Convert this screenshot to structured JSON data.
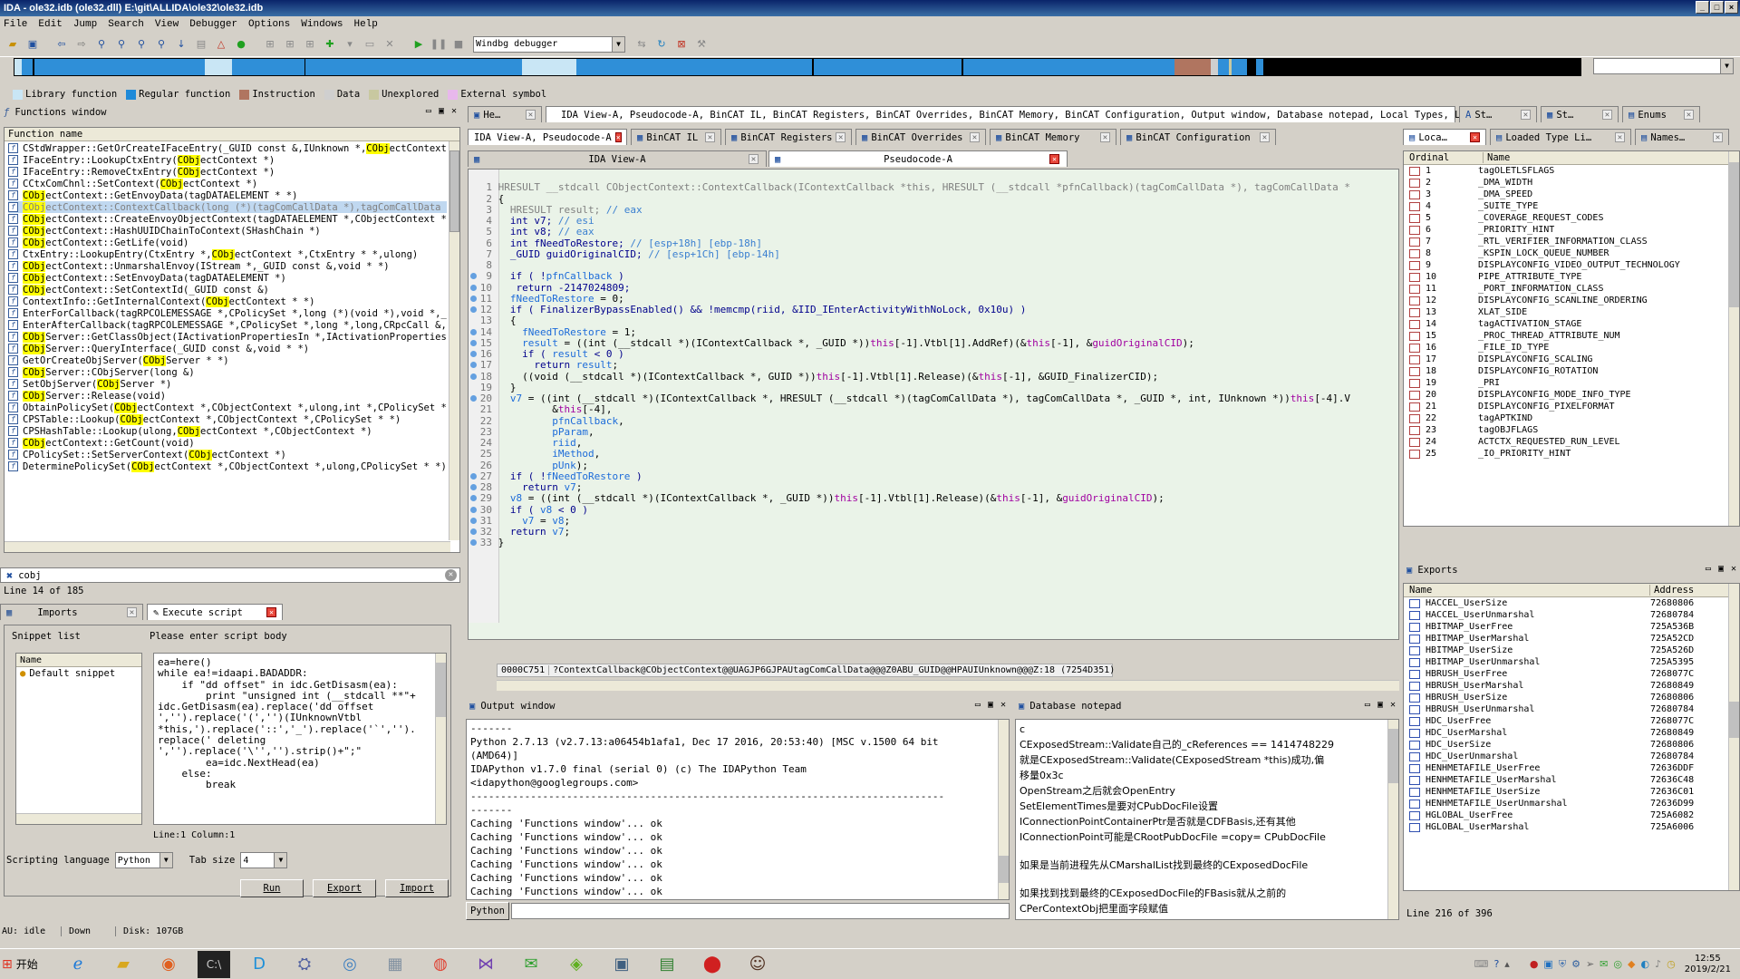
{
  "window": {
    "title": "IDA - ole32.idb (ole32.dll) E:\\git\\ALLIDA\\ole32\\ole32.idb",
    "min": "_",
    "max": "□",
    "close": "×"
  },
  "menu": [
    "File",
    "Edit",
    "Jump",
    "Search",
    "View",
    "Debugger",
    "Options",
    "Windows",
    "Help"
  ],
  "toolbar": {
    "debugger": "Windbg debugger"
  },
  "legend": [
    {
      "label": "Library function",
      "color": "#c9e6f5"
    },
    {
      "label": "Regular function",
      "color": "#1f8ad8"
    },
    {
      "label": "Instruction",
      "color": "#b07560"
    },
    {
      "label": "Data",
      "color": "#cfcfcf"
    },
    {
      "label": "Unexplored",
      "color": "#c8c8a0"
    },
    {
      "label": "External symbol",
      "color": "#e8b8ec"
    }
  ],
  "functions": {
    "title": "Functions window",
    "column": "Function name",
    "rows": [
      {
        "pre": "CStdWrapper::GetOrCreateIFaceEntry(_GUID const &,IUnknown *,",
        "hl": "CObj",
        "post": "ectContext *,"
      },
      {
        "pre": "IFaceEntry::LookupCtxEntry(",
        "hl": "CObj",
        "post": "ectContext *)"
      },
      {
        "pre": "IFaceEntry::RemoveCtxEntry(",
        "hl": "CObj",
        "post": "ectContext *)"
      },
      {
        "pre": "CCtxComChnl::SetContext(",
        "hl": "CObj",
        "post": "ectContext *)"
      },
      {
        "pre": "",
        "hl": "CObj",
        "post": "ectContext::GetEnvoyData(tagDATAELEMENT * *)"
      },
      {
        "pre": "",
        "hl": "CObj",
        "post": "ectContext::ContextCallback(long (*)(tagComCallData *),tagComCallData *,",
        "selected": true
      },
      {
        "pre": "",
        "hl": "CObj",
        "post": "ectContext::CreateEnvoyObjectContext(tagDATAELEMENT *,CObjectContext * &)"
      },
      {
        "pre": "",
        "hl": "CObj",
        "post": "ectContext::HashUUIDChainToContext(SHashChain *)"
      },
      {
        "pre": "",
        "hl": "CObj",
        "post": "ectContext::GetLife(void)"
      },
      {
        "pre": "CtxEntry::LookupEntry(CtxEntry *,",
        "hl": "CObj",
        "post": "ectContext *,CtxEntry * *,ulong)"
      },
      {
        "pre": "",
        "hl": "CObj",
        "post": "ectContext::UnmarshalEnvoy(IStream *,_GUID const &,void * *)"
      },
      {
        "pre": "",
        "hl": "CObj",
        "post": "ectContext::SetEnvoyData(tagDATAELEMENT *)"
      },
      {
        "pre": "",
        "hl": "CObj",
        "post": "ectContext::SetContextId(_GUID const &)"
      },
      {
        "pre": "ContextInfo::GetInternalContext(",
        "hl": "CObj",
        "post": "ectContext * *)"
      },
      {
        "pre": "EnterForCallback(tagRPCOLEMESSAGE *,CPolicySet *,long (*)(void *),void *,_GUI",
        "hl": "",
        "post": ""
      },
      {
        "pre": "EnterAfterCallback(tagRPCOLEMESSAGE *,CPolicySet *,long *,long,CRpcCall &,",
        "hl": "COb",
        "post": ""
      },
      {
        "pre": "",
        "hl": "CObj",
        "post": "Server::GetClassObject(IActivationPropertiesIn *,IActivationPropertiesOut"
      },
      {
        "pre": "",
        "hl": "CObj",
        "post": "Server::QueryInterface(_GUID const &,void * *)"
      },
      {
        "pre": "GetOrCreateObjServer(",
        "hl": "CObj",
        "post": "Server * *)"
      },
      {
        "pre": "",
        "hl": "CObj",
        "post": "Server::CObjServer(long &)"
      },
      {
        "pre": "SetObjServer(",
        "hl": "CObj",
        "post": "Server *)"
      },
      {
        "pre": "",
        "hl": "CObj",
        "post": "Server::Release(void)"
      },
      {
        "pre": "ObtainPolicySet(",
        "hl": "CObj",
        "post": "ectContext *,CObjectContext *,ulong,int *,CPolicySet * *)"
      },
      {
        "pre": "CPSTable::Lookup(",
        "hl": "CObj",
        "post": "ectContext *,CObjectContext *,CPolicySet * *)"
      },
      {
        "pre": "CPSHashTable::Lookup(ulong,",
        "hl": "CObj",
        "post": "ectContext *,CObjectContext *)"
      },
      {
        "pre": "",
        "hl": "CObj",
        "post": "ectContext::GetCount(void)"
      },
      {
        "pre": "CPolicySet::SetServerContext(",
        "hl": "CObj",
        "post": "ectContext *)"
      },
      {
        "pre": "DeterminePolicySet(",
        "hl": "CObj",
        "post": "ectContext *,CObjectContext *,ulong,CPolicySet * *)"
      }
    ],
    "filter": "cobj",
    "status": "Line 14 of 185"
  },
  "script": {
    "tabs": [
      "Imports",
      "Execute script"
    ],
    "snippet_label": "Snippet list",
    "snippet_col": "Name",
    "snippet_item": "Default snippet",
    "body_label": "Please enter script body",
    "lines": [
      "ea=here()",
      "while ea!=idaapi.BADADDR:",
      "    if \"dd offset\" in idc.GetDisasm(ea):",
      "        print \"unsigned int (__stdcall **\"+",
      "idc.GetDisasm(ea).replace('dd offset",
      "','').replace('(','')(IUnknownVtbl",
      "*this,').replace('::','_').replace('`','').",
      "replace(' deleting",
      "','').replace('\\'','').strip()+\";\"",
      "        ea=idc.NextHead(ea)",
      "    else:",
      "        break"
    ],
    "pos": "Line:1  Column:1",
    "lang_label": "Scripting language",
    "lang": "Python",
    "tab_label": "Tab size",
    "tab_size": "4",
    "run": "Run",
    "export": "Export",
    "import": "Import"
  },
  "maintabs": [
    "He…",
    "IDA View-A, Pseudocode-A, BinCAT IL, BinCAT Registers, BinCAT Overrides, BinCAT Memory, BinCAT Configuration, Output window, Database notepad, Local Types, Loaded…",
    "St…",
    "St…",
    "Enums"
  ],
  "subtabs": [
    "IDA View-A, Pseudocode-A",
    "BinCAT IL",
    "BinCAT Registers",
    "BinCAT Overrides",
    "BinCAT Memory",
    "BinCAT Configuration"
  ],
  "viewtabs": [
    "IDA View-A",
    "Pseudocode-A"
  ],
  "pseudocode": {
    "status_addr": "0000C751",
    "status_sym": "?ContextCallback@CObjectContext@@UAGJP6GJPAUtagComCallData@@@Z0ABU_GUID@@HPAUIUnknown@@@Z:18 (7254D351)"
  },
  "output": {
    "title": "Output window",
    "lines": [
      "-------",
      "Python 2.7.13 (v2.7.13:a06454b1afa1, Dec 17 2016, 20:53:40) [MSC v.1500 64 bit",
      "(AMD64)]",
      "IDAPython v1.7.0 final (serial 0) (c) The IDAPython Team",
      "<idapython@googlegroups.com>",
      "-------------------------------------------------------------------------------",
      "-------",
      "Caching 'Functions window'... ok",
      "Caching 'Functions window'... ok",
      "Caching 'Functions window'... ok",
      "Caching 'Functions window'... ok",
      "Caching 'Functions window'... ok",
      "Caching 'Functions window'... ok"
    ],
    "prompt": "Python"
  },
  "notepad": {
    "title": "Database notepad",
    "lines": [
      "c",
      "CExposedStream::Validate自己的_cReferences == 1414748229",
      "就是CExposedStream::Validate(CExposedStream *this)成功,偏",
      "移量0x3c",
      "OpenStream之后就会OpenEntry",
      "SetElementTimes是要对CPubDocFile设置",
      "IConnectionPointContainerPtr是否就是CDFBasis,还有其他",
      "IConnectionPoint可能是CRootPubDocFile =copy= CPubDocFile",
      "",
      "如果是当前进程先从CMarshalList找到最终的CExposedDocFile",
      "",
      "如果找到找到最终的CExposedDocFile的FBasis就从之前的",
      "CPerContextObj把里面字段赋值"
    ]
  },
  "locals": {
    "tabs": [
      "Loca…",
      "Loaded Type Li…",
      "Names…"
    ],
    "col_ordinal": "Ordinal",
    "col_name": "Name",
    "rows": [
      [
        "1",
        "tagOLETLSFLAGS"
      ],
      [
        "2",
        "_DMA_WIDTH"
      ],
      [
        "3",
        "_DMA_SPEED"
      ],
      [
        "4",
        "_SUITE_TYPE"
      ],
      [
        "5",
        "_COVERAGE_REQUEST_CODES"
      ],
      [
        "6",
        "_PRIORITY_HINT"
      ],
      [
        "7",
        "_RTL_VERIFIER_INFORMATION_CLASS"
      ],
      [
        "8",
        "_KSPIN_LOCK_QUEUE_NUMBER"
      ],
      [
        "9",
        "DISPLAYCONFIG_VIDEO_OUTPUT_TECHNOLOGY"
      ],
      [
        "10",
        "PIPE_ATTRIBUTE_TYPE"
      ],
      [
        "11",
        "_PORT_INFORMATION_CLASS"
      ],
      [
        "12",
        "DISPLAYCONFIG_SCANLINE_ORDERING"
      ],
      [
        "13",
        "XLAT_SIDE"
      ],
      [
        "14",
        "tagACTIVATION_STAGE"
      ],
      [
        "15",
        "_PROC_THREAD_ATTRIBUTE_NUM"
      ],
      [
        "16",
        "_FILE_ID_TYPE"
      ],
      [
        "17",
        "DISPLAYCONFIG_SCALING"
      ],
      [
        "18",
        "DISPLAYCONFIG_ROTATION"
      ],
      [
        "19",
        "_PRI"
      ],
      [
        "20",
        "DISPLAYCONFIG_MODE_INFO_TYPE"
      ],
      [
        "21",
        "DISPLAYCONFIG_PIXELFORMAT"
      ],
      [
        "22",
        "tagAPTKIND"
      ],
      [
        "23",
        "tagOBJFLAGS"
      ],
      [
        "24",
        "ACTCTX_REQUESTED_RUN_LEVEL"
      ],
      [
        "25",
        "_IO_PRIORITY_HINT"
      ]
    ]
  },
  "exports": {
    "title": "Exports",
    "col_name": "Name",
    "col_addr": "Address",
    "rows": [
      [
        "HACCEL_UserSize",
        "72680806"
      ],
      [
        "HACCEL_UserUnmarshal",
        "72680784"
      ],
      [
        "HBITMAP_UserFree",
        "725A536B"
      ],
      [
        "HBITMAP_UserMarshal",
        "725A52CD"
      ],
      [
        "HBITMAP_UserSize",
        "725A526D"
      ],
      [
        "HBITMAP_UserUnmarshal",
        "725A5395"
      ],
      [
        "HBRUSH_UserFree",
        "7268077C"
      ],
      [
        "HBRUSH_UserMarshal",
        "72680849"
      ],
      [
        "HBRUSH_UserSize",
        "72680806"
      ],
      [
        "HBRUSH_UserUnmarshal",
        "72680784"
      ],
      [
        "HDC_UserFree",
        "7268077C"
      ],
      [
        "HDC_UserMarshal",
        "72680849"
      ],
      [
        "HDC_UserSize",
        "72680806"
      ],
      [
        "HDC_UserUnmarshal",
        "72680784"
      ],
      [
        "HENHMETAFILE_UserFree",
        "72636DDF"
      ],
      [
        "HENHMETAFILE_UserMarshal",
        "72636C48"
      ],
      [
        "HENHMETAFILE_UserSize",
        "72636C01"
      ],
      [
        "HENHMETAFILE_UserUnmarshal",
        "72636D99"
      ],
      [
        "HGLOBAL_UserFree",
        "725A6082"
      ],
      [
        "HGLOBAL_UserMarshal",
        "725A6006"
      ]
    ],
    "status": "Line 216 of 396"
  },
  "statusbar": {
    "au": "AU:  idle",
    "dir": "Down",
    "disk": "Disk: 107GB"
  },
  "taskbar": {
    "start": "开始",
    "time": "12:55",
    "date": "2019/2/21"
  }
}
